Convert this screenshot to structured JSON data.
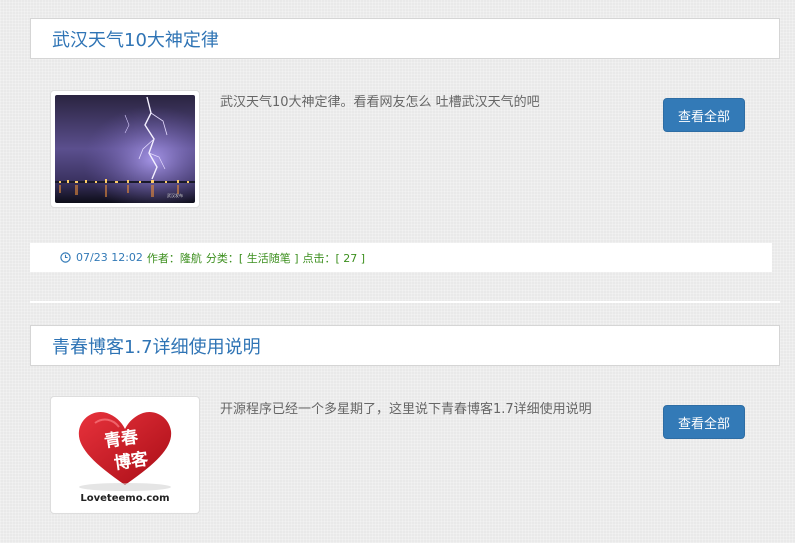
{
  "posts": [
    {
      "title": "武汉天气10大神定律",
      "excerpt": "武汉天气10大神定律。看看网友怎么 吐槽武汉天气的吧",
      "button_label": "查看全部",
      "thumbnail_icon": "lightning-photo",
      "thumbnail_caption": "武汉发布",
      "meta": {
        "icon": "clock-icon",
        "date": "07/23 12:02",
        "author": "作者：隆航",
        "category": "分类：[ 生活随笔 ]",
        "clicks": "点击：[ 27 ]"
      }
    },
    {
      "title": "青春博客1.7详细使用说明",
      "excerpt": "开源程序已经一个多星期了，这里说下青春博客1.7详细使用说明",
      "button_label": "查看全部",
      "thumbnail_icon": "heart-logo",
      "logo_text_line1": "青春",
      "logo_text_line2": "博客",
      "logo_site": "Loveteemo.com"
    }
  ],
  "colors": {
    "title": "#2f74b5",
    "button": "#337ab7",
    "meta": "#3c8f1e",
    "heart": "#c8141e"
  }
}
